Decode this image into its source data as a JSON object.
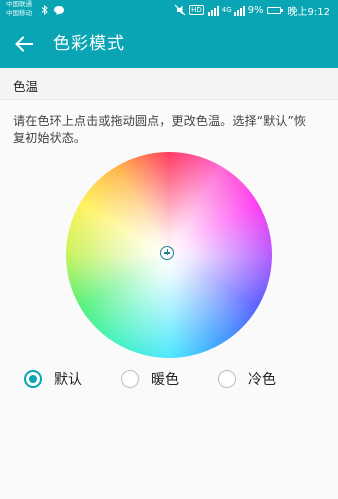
{
  "status_bar": {
    "carrier_1": "中国联通",
    "carrier_2": "中国移动",
    "hd": "HD",
    "signal": "4G",
    "battery": "9%",
    "time": "晚上9:12"
  },
  "toolbar": {
    "title": "色彩模式"
  },
  "section": {
    "title": "色温"
  },
  "description": "请在色环上点击或拖动圆点，更改色温。选择“默认”恢复初始状态。",
  "options": [
    {
      "label": "默认",
      "checked": true
    },
    {
      "label": "暖色",
      "checked": false
    },
    {
      "label": "冷色",
      "checked": false
    }
  ],
  "colors": {
    "accent": "#0aa5b5",
    "background": "#fafafa"
  }
}
